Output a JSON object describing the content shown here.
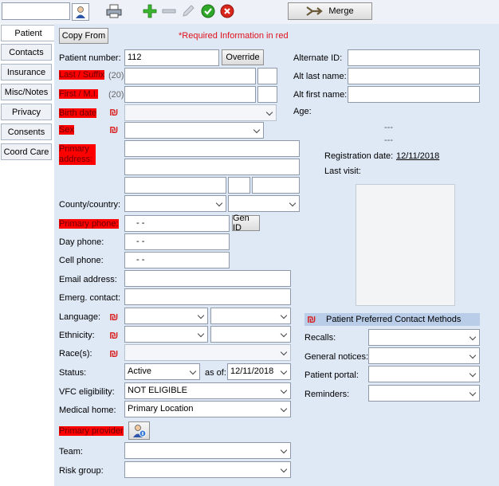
{
  "toolbar": {
    "search_value": "",
    "merge_label": "Merge"
  },
  "tabs": [
    "Patient",
    "Contacts",
    "Insurance",
    "Misc/Notes",
    "Privacy",
    "Consents",
    "Coord Care"
  ],
  "form": {
    "copy_from_label": "Copy From",
    "required_note": "*Required Information in red",
    "patient_number_label": "Patient number:",
    "patient_number_value": "112",
    "override_label": "Override",
    "last_suffix_label": "Last / Suffix",
    "last_count": "(20)",
    "first_mi_label": "First / M.I.",
    "first_count": "(20)",
    "birth_date_label": "Birth date",
    "sex_label": "Sex",
    "primary_address_label": "Primary address:",
    "county_country_label": "County/country:",
    "primary_phone_label": "Primary phone:",
    "primary_phone_value": "-   -",
    "gen_id_label": "Gen ID",
    "day_phone_label": "Day phone:",
    "day_phone_value": "-   -",
    "cell_phone_label": "Cell phone:",
    "cell_phone_value": "-   -",
    "email_label": "Email address:",
    "emerg_contact_label": "Emerg. contact:",
    "language_label": "Language:",
    "ethnicity_label": "Ethnicity:",
    "race_label": "Race(s):",
    "status_label": "Status:",
    "status_value": "Active",
    "as_of_label": "as of:",
    "as_of_value": "12/11/2018",
    "vfc_label": "VFC eligibility:",
    "vfc_value": "NOT ELIGIBLE",
    "medical_home_label": "Medical home:",
    "medical_home_value": "Primary Location",
    "primary_provider_label": "Primary provider",
    "team_label": "Team:",
    "risk_group_label": "Risk group:",
    "required_symbol": "₪"
  },
  "right": {
    "alternate_id_label": "Alternate ID:",
    "alt_last_label": "Alt last name:",
    "alt_first_label": "Alt first name:",
    "age_label": "Age:",
    "dash1": "---",
    "dash2": "---",
    "registration_label": "Registration date:",
    "registration_value": "12/11/2018",
    "last_visit_label": "Last visit:",
    "contact_methods_header": "Patient Preferred Contact Methods",
    "recalls_label": "Recalls:",
    "general_notices_label": "General notices:",
    "patient_portal_label": "Patient portal:",
    "reminders_label": "Reminders:"
  },
  "icon_names": [
    "patient-search-icon",
    "print-icon",
    "add-icon",
    "delete-icon",
    "edit-icon",
    "confirm-icon",
    "cancel-icon",
    "merge-arrow-icon",
    "provider-lookup-icon"
  ],
  "colors": {
    "required": "#ff0000",
    "background": "#dfe8f5",
    "header": "#b9cde9"
  }
}
